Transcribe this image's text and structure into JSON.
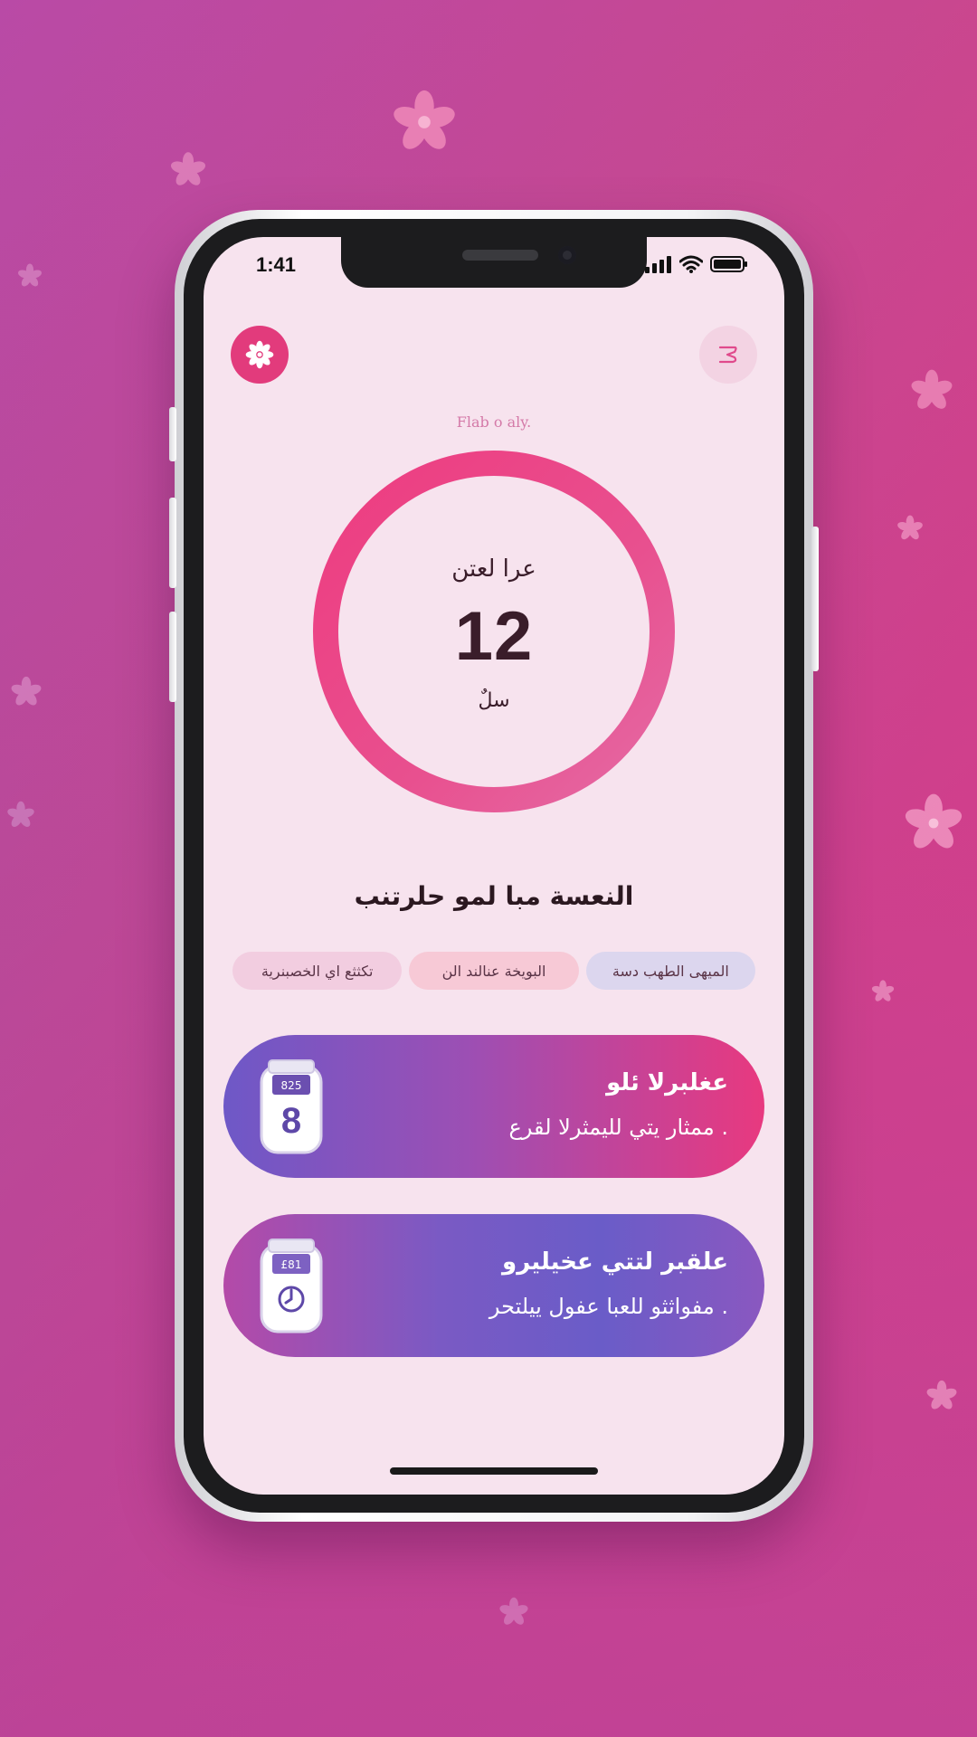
{
  "status_bar": {
    "time": "1:41"
  },
  "header": {
    "left_icon": "flower-icon",
    "right_icon": "profile-icon",
    "caption": "Flab o aly."
  },
  "cycle_ring": {
    "label_top": "عرا لعتن",
    "day_number": "12",
    "label_bottom": "سلٌ"
  },
  "section": {
    "title": "النعسة مبا لمو حلرتنب"
  },
  "chips": [
    {
      "label": "تكثثع اي الخصبنرية",
      "color": "#f2cde0"
    },
    {
      "label": "البويخة عنالند الن",
      "color": "#f7c9d6"
    },
    {
      "label": "الميهى الطهب دسة",
      "color": "#dcd6ee"
    }
  ],
  "cards": [
    {
      "icon": "calendar-icon",
      "icon_header": "825",
      "icon_value": "8",
      "line1": "عغلبرلا ئلو",
      "line2": "ممثار يتي لليمثرلا لقرع ."
    },
    {
      "icon": "calendar-timer-icon",
      "icon_header": "£81",
      "line1": "علقبر لتتي عخيليرو",
      "line2": "مفواثثو للعبا عفول ييلتحر ."
    }
  ],
  "colors": {
    "accent": "#e23b7c",
    "ring_start": "#ee3c80",
    "ring_end": "#e56aa4",
    "screen_bg": "#f7e3ee",
    "text_dark": "#3a1d2a"
  }
}
